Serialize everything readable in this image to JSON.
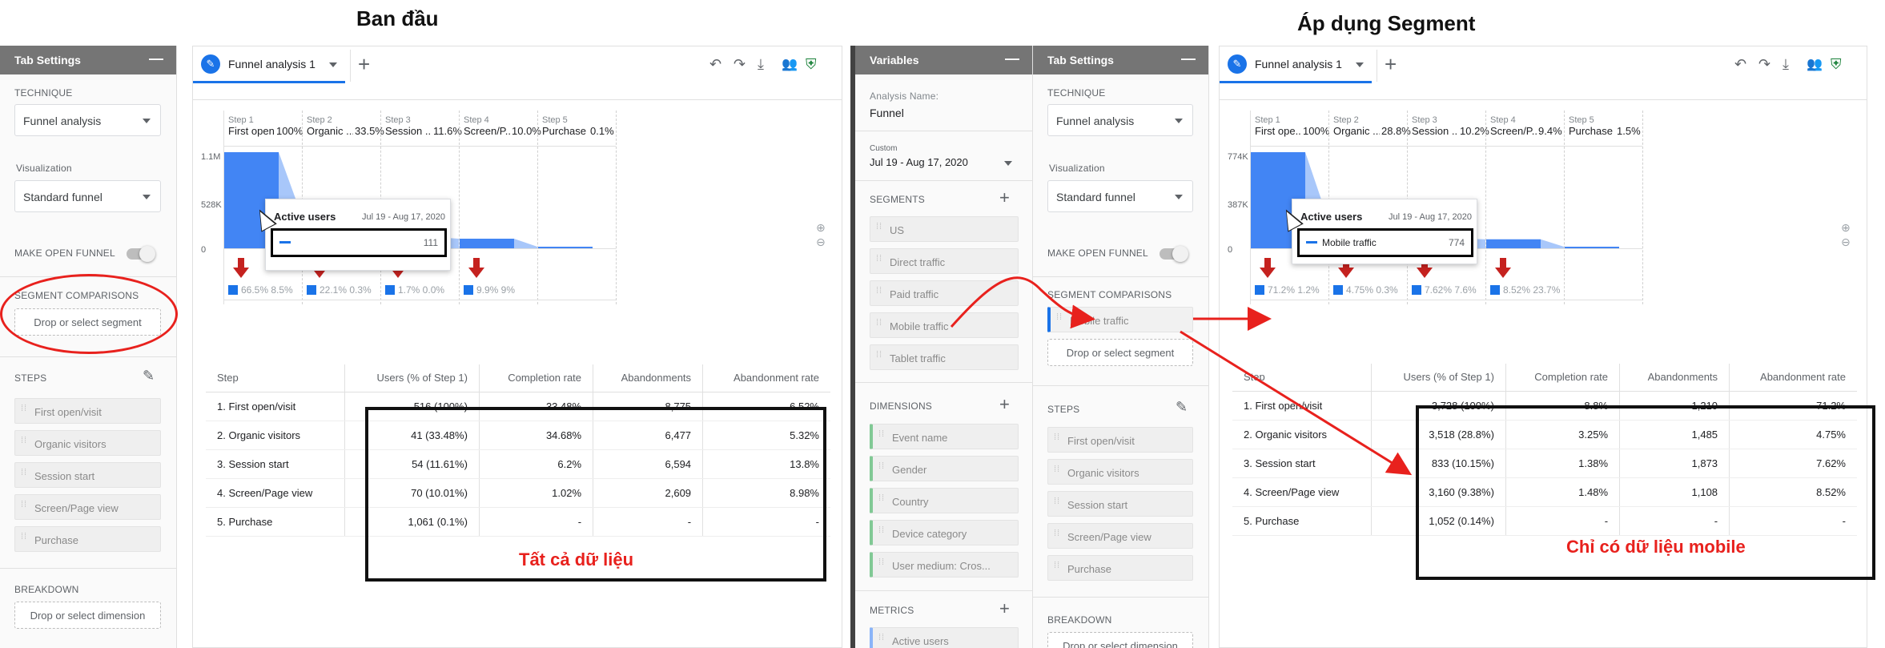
{
  "headings": {
    "left": "Ban đầu",
    "right": "Áp dụng Segment"
  },
  "colors": {
    "accent": "#1a73e8",
    "bar": "#4285f4",
    "arrow": "#c5221f",
    "annotation": "#e8211d"
  },
  "left": {
    "tab_settings": {
      "title": "Tab Settings",
      "technique_label": "TECHNIQUE",
      "technique_value": "Funnel analysis",
      "visualization_label": "Visualization",
      "visualization_value": "Standard funnel",
      "open_funnel_label": "MAKE OPEN FUNNEL",
      "segment_comparisons_label": "SEGMENT COMPARISONS",
      "segment_drop": "Drop or select segment",
      "steps_label": "STEPS",
      "steps": [
        "First open/visit",
        "Organic visitors",
        "Session start",
        "Screen/Page view",
        "Purchase"
      ],
      "breakdown_label": "BREAKDOWN",
      "breakdown_drop": "Drop or select dimension"
    },
    "tab_name": "Funnel analysis 1",
    "steps_header": [
      {
        "num": "Step 1",
        "name": "First open...",
        "pct": "100%"
      },
      {
        "num": "Step 2",
        "name": "Organic ...",
        "pct": "33.5%"
      },
      {
        "num": "Step 3",
        "name": "Session ...",
        "pct": "11.6%"
      },
      {
        "num": "Step 4",
        "name": "Screen/P...",
        "pct": "10.0%"
      },
      {
        "num": "Step 5",
        "name": "Purchase",
        "pct": "0.1%"
      }
    ],
    "y_axis": [
      "1.1M",
      "528K",
      "0"
    ],
    "bar_values": [
      1.0,
      0.3348,
      0.1161,
      0.1001,
      0.001
    ],
    "legend": [
      "66.5% 8.5%",
      "22.1% 0.3%",
      "1.7% 0.0%",
      "9.9% 9%"
    ],
    "tooltip": {
      "title": "Active users",
      "date": "Jul 19 - Aug 17, 2020",
      "value": "111"
    },
    "table": {
      "headers": [
        "Step",
        "Users (% of Step 1)",
        "Completion rate",
        "Abandonments",
        "Abandonment rate"
      ],
      "rows": [
        [
          "1. First open/visit",
          "516 (100%)",
          "33.48%",
          "8,775",
          "6.52%"
        ],
        [
          "2. Organic visitors",
          "41 (33.48%)",
          "34.68%",
          "6,477",
          "5.32%"
        ],
        [
          "3. Session start",
          "54 (11.61%)",
          "6.2%",
          "6,594",
          "13.8%"
        ],
        [
          "4. Screen/Page view",
          "70 (10.01%)",
          "1.02%",
          "2,609",
          "8.98%"
        ],
        [
          "5. Purchase",
          "1,061 (0.1%)",
          "-",
          "-",
          "-"
        ]
      ]
    },
    "caption": "Tất cả dữ liệu"
  },
  "variables": {
    "title": "Variables",
    "analysis_name_label": "Analysis Name:",
    "analysis_name_value": "Funnel",
    "date_label": "Custom",
    "date_value": "Jul 19 - Aug 17, 2020",
    "segments_label": "SEGMENTS",
    "segments": [
      "US",
      "Direct traffic",
      "Paid traffic",
      "Mobile traffic",
      "Tablet traffic"
    ],
    "dimensions_label": "DIMENSIONS",
    "dimensions": [
      "Event name",
      "Gender",
      "Country",
      "Device category",
      "User medium: Cros..."
    ],
    "metrics_label": "METRICS",
    "metrics": [
      "Active users"
    ]
  },
  "right": {
    "tab_settings": {
      "title": "Tab Settings",
      "technique_label": "TECHNIQUE",
      "technique_value": "Funnel analysis",
      "visualization_label": "Visualization",
      "visualization_value": "Standard funnel",
      "open_funnel_label": "MAKE OPEN FUNNEL",
      "segment_comparisons_label": "SEGMENT COMPARISONS",
      "segment_applied": "Mobile traffic",
      "segment_drop": "Drop or select segment",
      "steps_label": "STEPS",
      "steps": [
        "First open/visit",
        "Organic visitors",
        "Session start",
        "Screen/Page view",
        "Purchase"
      ],
      "breakdown_label": "BREAKDOWN",
      "breakdown_drop": "Drop or select dimension"
    },
    "tab_name": "Funnel analysis 1",
    "steps_header": [
      {
        "num": "Step 1",
        "name": "First ope...",
        "pct": "100%"
      },
      {
        "num": "Step 2",
        "name": "Organic ...",
        "pct": "28.8%"
      },
      {
        "num": "Step 3",
        "name": "Session ...",
        "pct": "10.2%"
      },
      {
        "num": "Step 4",
        "name": "Screen/P...",
        "pct": "9.4%"
      },
      {
        "num": "Step 5",
        "name": "Purchase",
        "pct": "1.5%"
      }
    ],
    "y_axis": [
      "774K",
      "387K",
      "0"
    ],
    "bar_values": [
      1.0,
      0.288,
      0.1015,
      0.0938,
      0.0014
    ],
    "legend": [
      "71.2% 1.2%",
      "4.75% 0.3%",
      "7.62% 7.6%",
      "8.52% 23.7%"
    ],
    "tooltip": {
      "title": "Active users",
      "date": "Jul 19 - Aug 17, 2020",
      "series": "Mobile traffic",
      "value": "774"
    },
    "table": {
      "headers": [
        "Step",
        "Users (% of Step 1)",
        "Completion rate",
        "Abandonments",
        "Abandonment rate"
      ],
      "rows": [
        [
          "1. First open/visit",
          "3,728 (100%)",
          "8.8%",
          "1,210",
          "71.2%"
        ],
        [
          "2. Organic visitors",
          "3,518 (28.8%)",
          "3.25%",
          "1,485",
          "4.75%"
        ],
        [
          "3. Session start",
          "833 (10.15%)",
          "1.38%",
          "1,873",
          "7.62%"
        ],
        [
          "4. Screen/Page view",
          "3,160 (9.38%)",
          "1.48%",
          "1,108",
          "8.52%"
        ],
        [
          "5. Purchase",
          "1,052 (0.14%)",
          "-",
          "-",
          "-"
        ]
      ]
    },
    "caption": "Chỉ có dữ liệu mobile"
  }
}
